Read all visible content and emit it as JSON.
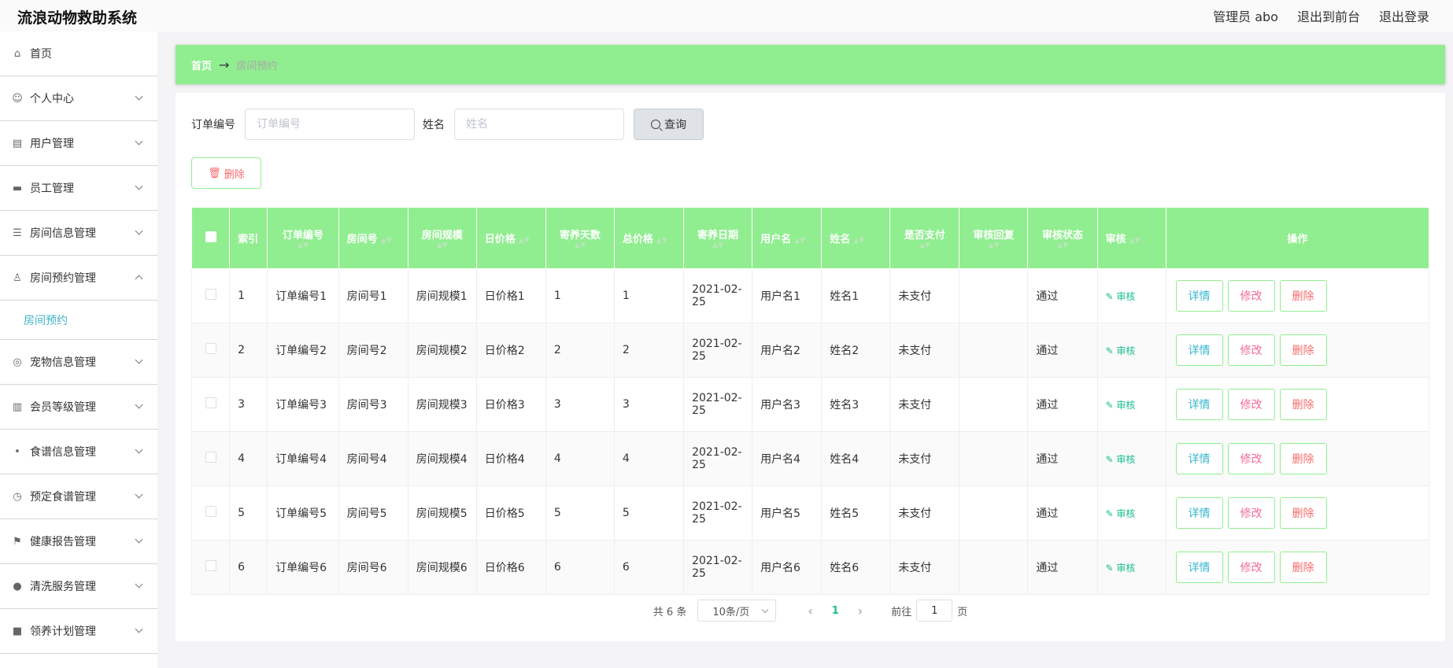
{
  "app": {
    "title": "流浪动物救助系统",
    "top_actions": [
      "管理员 abo",
      "退出到前台",
      "退出登录"
    ]
  },
  "sidebar": {
    "items": [
      {
        "label": "首页",
        "icon": "home-icon",
        "expandable": false
      },
      {
        "label": "个人中心",
        "icon": "user-icon",
        "expandable": true
      },
      {
        "label": "用户管理",
        "icon": "id-card-icon",
        "expandable": true
      },
      {
        "label": "员工管理",
        "icon": "desk-icon",
        "expandable": true
      },
      {
        "label": "房间信息管理",
        "icon": "list-icon",
        "expandable": true
      },
      {
        "label": "房间预约管理",
        "icon": "person-icon",
        "expandable": true,
        "expanded": true,
        "children": [
          "房间预约"
        ]
      },
      {
        "label": "宠物信息管理",
        "icon": "aperture-icon",
        "expandable": true
      },
      {
        "label": "会员等级管理",
        "icon": "clipboard-icon",
        "expandable": true
      },
      {
        "label": "食谱信息管理",
        "icon": "mic-icon",
        "expandable": true
      },
      {
        "label": "预定食谱管理",
        "icon": "clock-icon",
        "expandable": true
      },
      {
        "label": "健康报告管理",
        "icon": "flag-icon",
        "expandable": true
      },
      {
        "label": "清洗服务管理",
        "icon": "bulb-icon",
        "expandable": true
      },
      {
        "label": "领养计划管理",
        "icon": "stand-icon",
        "expandable": true
      }
    ]
  },
  "breadcrumb": {
    "home": "首页",
    "separator": "→",
    "current": "房间预约"
  },
  "search": {
    "order_label": "订单编号",
    "order_placeholder": "订单编号",
    "name_label": "姓名",
    "name_placeholder": "姓名",
    "query_label": "查询"
  },
  "toolbar": {
    "delete_label": "删除"
  },
  "table": {
    "columns": [
      "索引",
      "订单编号",
      "房间号",
      "房间规模",
      "日价格",
      "寄养天数",
      "总价格",
      "寄养日期",
      "用户名",
      "姓名",
      "是否支付",
      "审核回复",
      "审核状态",
      "审核",
      "操作"
    ],
    "audit_label": "审核",
    "op_labels": {
      "detail": "详情",
      "edit": "修改",
      "delete": "删除"
    },
    "rows": [
      {
        "index": "1",
        "order": "订单编号1",
        "room": "房间号1",
        "scale": "房间规模1",
        "price": "日价格1",
        "days": "1",
        "total": "1",
        "date": "2021-02-25",
        "user": "用户名1",
        "name": "姓名1",
        "paid": "未支付",
        "reply": "",
        "status": "通过"
      },
      {
        "index": "2",
        "order": "订单编号2",
        "room": "房间号2",
        "scale": "房间规模2",
        "price": "日价格2",
        "days": "2",
        "total": "2",
        "date": "2021-02-25",
        "user": "用户名2",
        "name": "姓名2",
        "paid": "未支付",
        "reply": "",
        "status": "通过"
      },
      {
        "index": "3",
        "order": "订单编号3",
        "room": "房间号3",
        "scale": "房间规模3",
        "price": "日价格3",
        "days": "3",
        "total": "3",
        "date": "2021-02-25",
        "user": "用户名3",
        "name": "姓名3",
        "paid": "未支付",
        "reply": "",
        "status": "通过"
      },
      {
        "index": "4",
        "order": "订单编号4",
        "room": "房间号4",
        "scale": "房间规模4",
        "price": "日价格4",
        "days": "4",
        "total": "4",
        "date": "2021-02-25",
        "user": "用户名4",
        "name": "姓名4",
        "paid": "未支付",
        "reply": "",
        "status": "通过"
      },
      {
        "index": "5",
        "order": "订单编号5",
        "room": "房间号5",
        "scale": "房间规模5",
        "price": "日价格5",
        "days": "5",
        "total": "5",
        "date": "2021-02-25",
        "user": "用户名5",
        "name": "姓名5",
        "paid": "未支付",
        "reply": "",
        "status": "通过"
      },
      {
        "index": "6",
        "order": "订单编号6",
        "room": "房间号6",
        "scale": "房间规模6",
        "price": "日价格6",
        "days": "6",
        "total": "6",
        "date": "2021-02-25",
        "user": "用户名6",
        "name": "姓名6",
        "paid": "未支付",
        "reply": "",
        "status": "通过"
      }
    ]
  },
  "pagination": {
    "total_text": "共 6 条",
    "page_size": "10条/页",
    "current_page": "1",
    "goto_prefix": "前往",
    "goto_value": "1",
    "goto_suffix": "页"
  },
  "colors": {
    "accent": "#90ee90",
    "link": "#3fb3c7",
    "danger": "#f56c6c",
    "edit": "#f26a9d",
    "success": "#19be8f"
  }
}
